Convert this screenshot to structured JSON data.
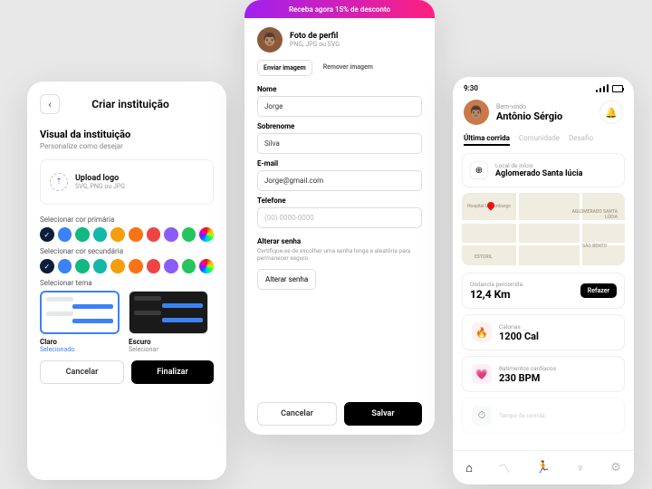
{
  "screen1": {
    "title": "Criar instituição",
    "section_title": "Visual da instituição",
    "section_subtitle": "Personalize como desejar",
    "upload": {
      "title": "Upload logo",
      "hint": "SVG, PNG ou JPG"
    },
    "primary_label": "Selecionar cor primária",
    "secondary_label": "Selecionar cor secundária",
    "theme_label": "Selecionar tema",
    "colors": [
      "#0b1f3a",
      "#3b82f6",
      "#10b981",
      "#14b8a6",
      "#f59e0b",
      "#f97316",
      "#ef4444",
      "#8b5cf6",
      "#22c55e"
    ],
    "themes": [
      {
        "name": "Claro",
        "state": "Selecionado",
        "selected": true
      },
      {
        "name": "Escuro",
        "state": "Selecionar",
        "selected": false
      }
    ],
    "cancel": "Cancelar",
    "finish": "Finalizar"
  },
  "screen2": {
    "banner": "Receba agora 15% de desconto",
    "profile": {
      "title": "Foto de perfil",
      "hint": "PNG, JPG ou SVG"
    },
    "send_image": "Enviar imagem",
    "remove_image": "Remover imagem",
    "name_label": "Nome",
    "name_value": "Jorge",
    "surname_label": "Sobrenome",
    "surname_value": "Silva",
    "email_label": "E-mail",
    "email_value": "Jorge@gmail.com",
    "phone_label": "Telefone",
    "phone_placeholder": "(00) 0000-0000",
    "password_title": "Alterar senha",
    "password_hint": "Certifique-se de escolher uma senha longa e aleatória para permanecer seguro.",
    "password_btn": "Alterar senha",
    "cancel": "Cancelar",
    "save": "Salvar"
  },
  "screen3": {
    "time": "9:30",
    "welcome": "Bem-vindo",
    "username": "Antônio Sérgio",
    "tabs": [
      "Última corrida",
      "Comunidade",
      "Desafio"
    ],
    "location_label": "Local de início",
    "location_value": "Aglomerado Santa lúcia",
    "map_labels": [
      "Hospital Luxemburgo",
      "AGLOMERADO SANTA LÚCIA",
      "SÃO BENTO",
      "ESTORIL"
    ],
    "distance_label": "Distancia percorrida",
    "distance_value": "12,4 Km",
    "redo": "Refazer",
    "calories_label": "Calorias",
    "calories_value": "1200 Cal",
    "bpm_label": "Batimentos cardíacos",
    "bpm_value": "230 BPM",
    "runtime_label": "Tempo de corrida"
  }
}
